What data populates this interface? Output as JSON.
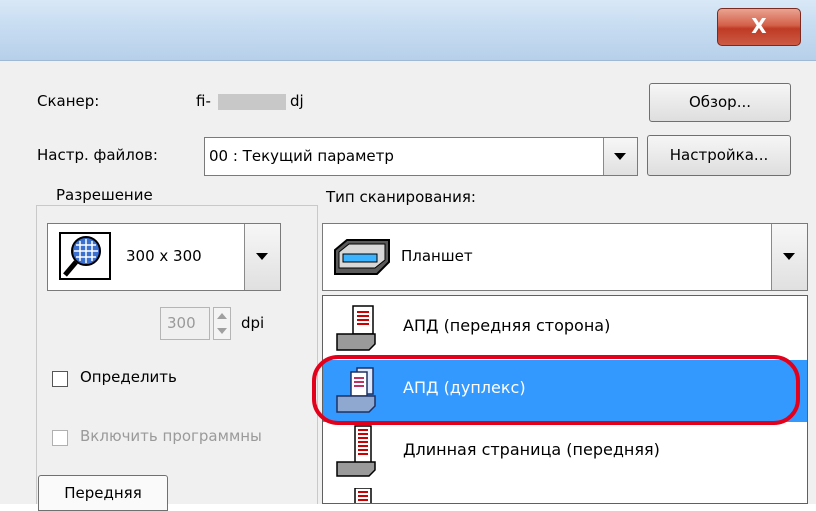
{
  "window": {
    "close_label": "X"
  },
  "scanner": {
    "label": "Сканер:",
    "name_prefix": "fi-",
    "name_suffix": "dj",
    "browse_button": "Обзор..."
  },
  "file_settings": {
    "label": "Настр. файлов:",
    "value": "00 : Текущий параметр",
    "setup_button": "Настройка..."
  },
  "resolution": {
    "group_label": "Разрешение",
    "value": "300 x 300",
    "dpi_value": "300",
    "dpi_unit": "dpi",
    "detect_label": "Определить"
  },
  "scan_type": {
    "label": "Тип сканирования:",
    "value": "Планшет",
    "options": [
      {
        "label": "АПД (передняя сторона)",
        "selected": false
      },
      {
        "label": "АПД (дуплекс)",
        "selected": true
      },
      {
        "label": "Длинная страница (передняя)",
        "selected": false
      }
    ]
  },
  "software_checkbox_label": "Включить программны",
  "front_tab": "Передняя"
}
